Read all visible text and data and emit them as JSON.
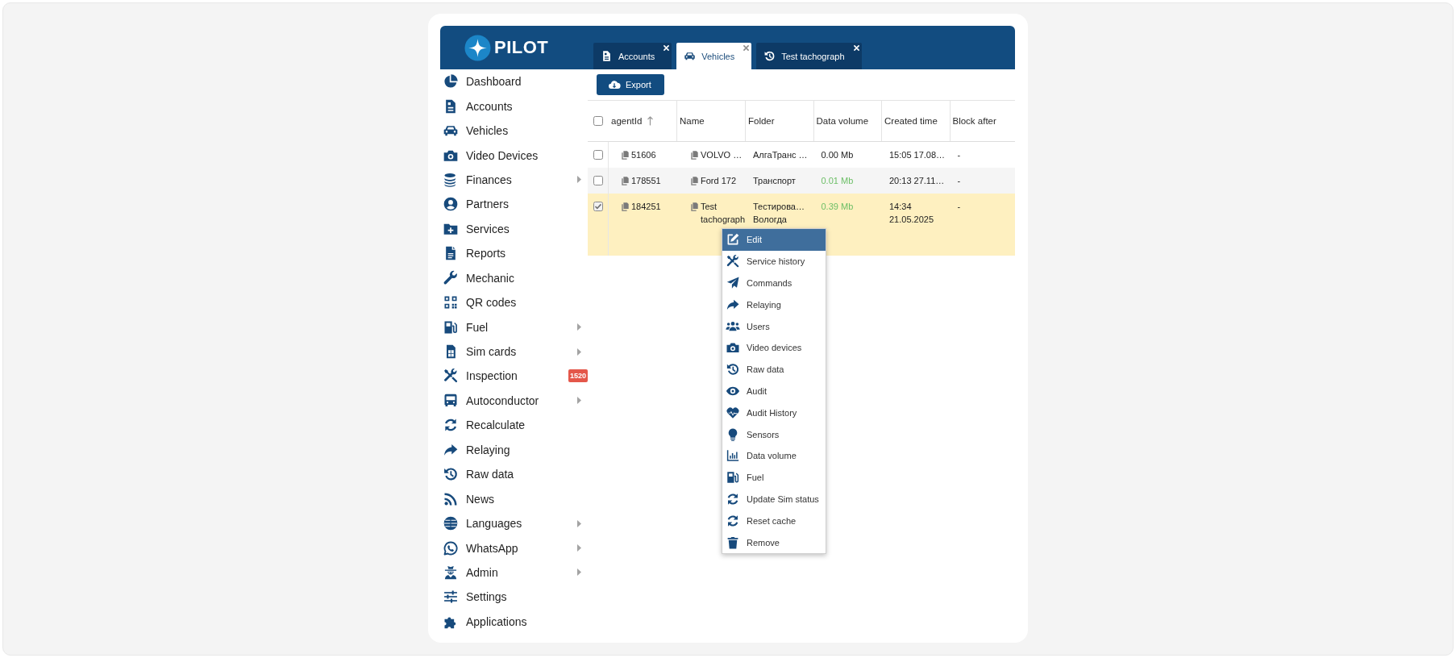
{
  "logo": {
    "text": "PILOT"
  },
  "tabs": [
    {
      "label": "Accounts",
      "selected": false
    },
    {
      "label": "Vehicles",
      "selected": true
    },
    {
      "label": "Test tachograph",
      "selected": false
    }
  ],
  "sidebar": {
    "items": [
      {
        "label": "Dashboard",
        "has_submenu": false
      },
      {
        "label": "Accounts",
        "has_submenu": false
      },
      {
        "label": "Vehicles",
        "has_submenu": false
      },
      {
        "label": "Video Devices",
        "has_submenu": false
      },
      {
        "label": "Finances",
        "has_submenu": true
      },
      {
        "label": "Partners",
        "has_submenu": false
      },
      {
        "label": "Services",
        "has_submenu": false
      },
      {
        "label": "Reports",
        "has_submenu": false
      },
      {
        "label": "Mechanic",
        "has_submenu": false
      },
      {
        "label": "QR codes",
        "has_submenu": false
      },
      {
        "label": "Fuel",
        "has_submenu": true
      },
      {
        "label": "Sim cards",
        "has_submenu": true
      },
      {
        "label": "Inspection",
        "has_submenu": false,
        "badge": "1520"
      },
      {
        "label": "Autoconductor",
        "has_submenu": true
      },
      {
        "label": "Recalculate",
        "has_submenu": false
      },
      {
        "label": "Relaying",
        "has_submenu": false
      },
      {
        "label": "Raw data",
        "has_submenu": false
      },
      {
        "label": "News",
        "has_submenu": false
      },
      {
        "label": "Languages",
        "has_submenu": true
      },
      {
        "label": "WhatsApp",
        "has_submenu": true
      },
      {
        "label": "Admin",
        "has_submenu": true
      },
      {
        "label": "Settings",
        "has_submenu": false
      },
      {
        "label": "Applications",
        "has_submenu": false
      }
    ]
  },
  "toolbar": {
    "export_button": "Export"
  },
  "table": {
    "select_all": {
      "checked": false
    },
    "columns": [
      {
        "label": "agentId",
        "sorted": true
      },
      {
        "label": "Name",
        "sorted": false
      },
      {
        "label": "Folder",
        "sorted": false
      },
      {
        "label": "Data volume",
        "sorted": false
      },
      {
        "label": "Created time",
        "sorted": false
      },
      {
        "label": "Block after",
        "sorted": false
      }
    ],
    "rows": [
      {
        "checked": false,
        "selected": false,
        "agent_id": "51606",
        "name": "VOLVO …",
        "folder": "АлгаТранс …",
        "data_volume": {
          "text": "0.00 Mb",
          "color": "#222222"
        },
        "created_time": "15:05 17.08…",
        "block_after": "-"
      },
      {
        "checked": false,
        "selected": false,
        "agent_id": "178551",
        "name": "Ford 172",
        "folder": "Транспорт",
        "data_volume": {
          "text": "0.01 Mb",
          "color": "#6dbf67"
        },
        "created_time": "20:13 27.11…",
        "block_after": "-"
      },
      {
        "checked": true,
        "selected": true,
        "agent_id": "184251",
        "name": "Test tachograph",
        "folder": "Тестирова… Вологда",
        "data_volume": {
          "text": "0.39 Mb",
          "color": "#6dbf67"
        },
        "created_time": "14:34 21.05.2025",
        "block_after": "-"
      }
    ]
  },
  "context_menu": {
    "items": [
      {
        "label": "Edit",
        "selected": true
      },
      {
        "label": "Service history",
        "selected": false
      },
      {
        "label": "Commands",
        "selected": false
      },
      {
        "label": "Relaying",
        "selected": false
      },
      {
        "label": "Users",
        "selected": false
      },
      {
        "label": "Video devices",
        "selected": false
      },
      {
        "label": "Raw data",
        "selected": false
      },
      {
        "label": "Audit",
        "selected": false
      },
      {
        "label": "Audit History",
        "selected": false
      },
      {
        "label": "Sensors",
        "selected": false
      },
      {
        "label": "Data volume",
        "selected": false
      },
      {
        "label": "Fuel",
        "selected": false
      },
      {
        "label": "Update Sim status",
        "selected": false
      },
      {
        "label": "Reset cache",
        "selected": false
      },
      {
        "label": "Remove",
        "selected": false
      }
    ]
  }
}
